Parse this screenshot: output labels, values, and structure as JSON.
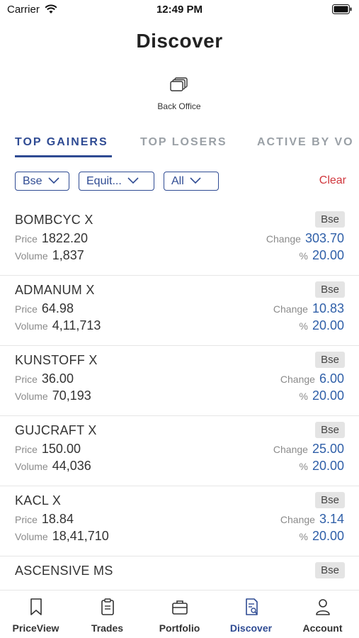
{
  "status_bar": {
    "carrier": "Carrier",
    "time": "12:49 PM"
  },
  "header": {
    "title": "Discover"
  },
  "back_office": {
    "label": "Back Office",
    "icon": "stacked-documents-icon"
  },
  "tabs": [
    {
      "label": "TOP GAINERS",
      "active": true
    },
    {
      "label": "TOP LOSERS",
      "active": false
    },
    {
      "label": "ACTIVE BY VO",
      "active": false
    }
  ],
  "filters": {
    "exchange": "Bse",
    "segment": "Equit...",
    "type": "All",
    "clear_label": "Clear"
  },
  "labels": {
    "price": "Price",
    "volume": "Volume",
    "change": "Change",
    "percent": "%"
  },
  "stocks": [
    {
      "name": "BOMBCYC X",
      "exchange": "Bse",
      "price": "1822.20",
      "volume": "1,837",
      "change": "303.70",
      "percent": "20.00"
    },
    {
      "name": "ADMANUM X",
      "exchange": "Bse",
      "price": "64.98",
      "volume": "4,11,713",
      "change": "10.83",
      "percent": "20.00"
    },
    {
      "name": "KUNSTOFF X",
      "exchange": "Bse",
      "price": "36.00",
      "volume": "70,193",
      "change": "6.00",
      "percent": "20.00"
    },
    {
      "name": "GUJCRAFT X",
      "exchange": "Bse",
      "price": "150.00",
      "volume": "44,036",
      "change": "25.00",
      "percent": "20.00"
    },
    {
      "name": "KACL X",
      "exchange": "Bse",
      "price": "18.84",
      "volume": "18,41,710",
      "change": "3.14",
      "percent": "20.00"
    },
    {
      "name": "ASCENSIVE MS",
      "exchange": "Bse"
    }
  ],
  "bottom_nav": [
    {
      "label": "PriceView",
      "icon": "bookmark-icon",
      "active": false
    },
    {
      "label": "Trades",
      "icon": "clipboard-icon",
      "active": false
    },
    {
      "label": "Portfolio",
      "icon": "briefcase-icon",
      "active": false
    },
    {
      "label": "Discover",
      "icon": "document-search-icon",
      "active": true
    },
    {
      "label": "Account",
      "icon": "person-icon",
      "active": false
    }
  ],
  "colors": {
    "accent": "#2f4b93",
    "value_blue": "#2f5fa8",
    "clear_red": "#d0363c"
  }
}
